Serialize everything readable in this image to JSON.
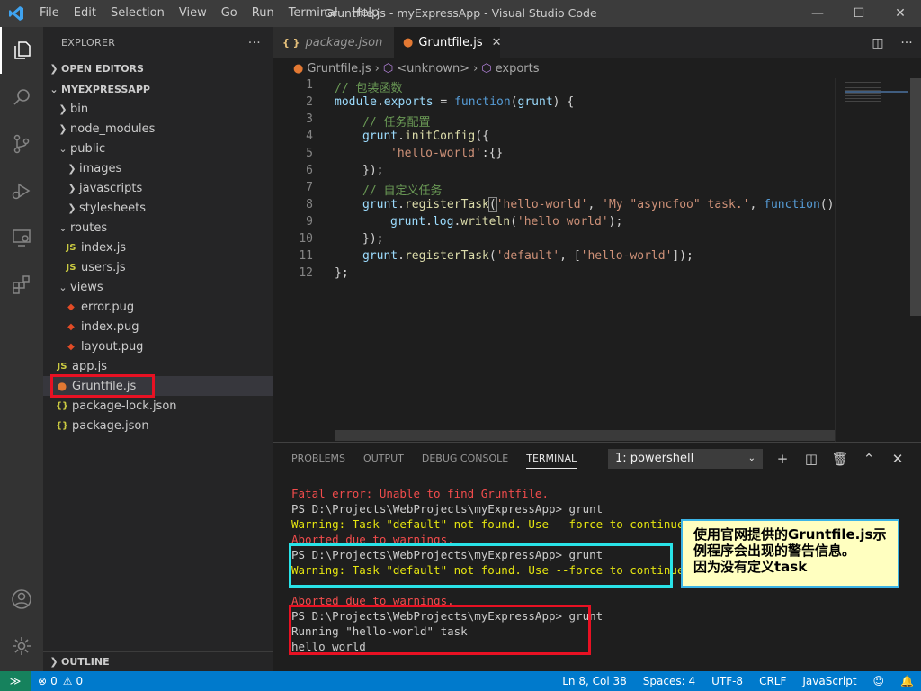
{
  "window": {
    "title": "Gruntfile.js - myExpressApp - Visual Studio Code",
    "menu": [
      "File",
      "Edit",
      "Selection",
      "View",
      "Go",
      "Run",
      "Terminal",
      "Help"
    ]
  },
  "sidebar": {
    "header": "EXPLORER",
    "more": "···",
    "open_editors": "OPEN EDITORS",
    "project": "MYEXPRESSAPP",
    "outline": "OUTLINE",
    "items": [
      {
        "label": "bin",
        "type": "folder",
        "depth": 0,
        "expanded": false
      },
      {
        "label": "node_modules",
        "type": "folder",
        "depth": 0,
        "expanded": false
      },
      {
        "label": "public",
        "type": "folder",
        "depth": 0,
        "expanded": true
      },
      {
        "label": "images",
        "type": "folder",
        "depth": 1,
        "expanded": false
      },
      {
        "label": "javascripts",
        "type": "folder",
        "depth": 1,
        "expanded": false
      },
      {
        "label": "stylesheets",
        "type": "folder",
        "depth": 1,
        "expanded": false
      },
      {
        "label": "routes",
        "type": "folder",
        "depth": 0,
        "expanded": true
      },
      {
        "label": "index.js",
        "type": "js",
        "depth": 1
      },
      {
        "label": "users.js",
        "type": "js",
        "depth": 1
      },
      {
        "label": "views",
        "type": "folder",
        "depth": 0,
        "expanded": true
      },
      {
        "label": "error.pug",
        "type": "pug",
        "depth": 1
      },
      {
        "label": "index.pug",
        "type": "pug",
        "depth": 1
      },
      {
        "label": "layout.pug",
        "type": "pug",
        "depth": 1
      },
      {
        "label": "app.js",
        "type": "js",
        "depth": 0
      },
      {
        "label": "Gruntfile.js",
        "type": "grunt",
        "depth": 0,
        "selected": true
      },
      {
        "label": "package-lock.json",
        "type": "json",
        "depth": 0
      },
      {
        "label": "package.json",
        "type": "json",
        "depth": 0
      }
    ]
  },
  "tabs": [
    {
      "label": "package.json",
      "active": false
    },
    {
      "label": "Gruntfile.js",
      "active": true
    }
  ],
  "breadcrumb": [
    "Gruntfile.js",
    "<unknown>",
    "exports"
  ],
  "code_lines": [
    "1",
    "2",
    "3",
    "4",
    "5",
    "6",
    "7",
    "8",
    "9",
    "10",
    "11",
    "12"
  ],
  "code": {
    "l1": "// 包装函数",
    "l2a": "module",
    "l2b": ".",
    "l2c": "exports",
    "l2d": " = ",
    "l2e": "function",
    "l2f": "(",
    "l2g": "grunt",
    "l2h": ") {",
    "l3": "// 任务配置",
    "l4a": "grunt",
    "l4b": ".",
    "l4c": "initConfig",
    "l4d": "({",
    "l5a": "'hello-world'",
    "l5b": ":{}",
    "l6": "});",
    "l7": "// 自定义任务",
    "l8a": "grunt",
    "l8b": ".",
    "l8c": "registerTask",
    "l8d": "(",
    "l8e": "'hello-world'",
    "l8f": ", ",
    "l8g": "'My \"asyncfoo\" task.'",
    "l8h": ", ",
    "l8i": "function",
    "l8j": "() {",
    "l9a": "grunt",
    "l9b": ".",
    "l9c": "log",
    "l9d": ".",
    "l9e": "writeln",
    "l9f": "(",
    "l9g": "'hello world'",
    "l9h": ");",
    "l10": "});",
    "l11a": "grunt",
    "l11b": ".",
    "l11c": "registerTask",
    "l11d": "(",
    "l11e": "'default'",
    "l11f": ", [",
    "l11g": "'hello-world'",
    "l11h": "]);",
    "l12": "};"
  },
  "panel": {
    "tabs": [
      "PROBLEMS",
      "OUTPUT",
      "DEBUG CONSOLE",
      "TERMINAL"
    ],
    "active_tab": "TERMINAL",
    "terminal_select": "1: powershell",
    "lines": [
      {
        "text": "Fatal error: Unable to find Gruntfile.",
        "color": "#f14c4c"
      },
      {
        "text": "PS D:\\Projects\\WebProjects\\myExpressApp> grunt",
        "color": "#cccccc"
      },
      {
        "text": "Warning: Task \"default\" not found. Use --force to continue.",
        "color": "#e5e510"
      },
      {
        "text": "Aborted due to warnings.",
        "color": "#f14c4c"
      },
      {
        "text": "PS D:\\Projects\\WebProjects\\myExpressApp> grunt",
        "color": "#cccccc"
      },
      {
        "text": "Warning: Task \"default\" not found. Use --force to continue.",
        "color": "#e5e510"
      },
      {
        "text": "",
        "color": "#cccccc"
      },
      {
        "text": "Aborted due to warnings.",
        "color": "#f14c4c"
      },
      {
        "text": "PS D:\\Projects\\WebProjects\\myExpressApp> grunt",
        "color": "#cccccc"
      },
      {
        "text": "Running \"hello-world\" task",
        "color": "#cccccc"
      },
      {
        "text": "hello world",
        "color": "#cccccc"
      }
    ]
  },
  "annotation": {
    "line1": "使用官网提供的Gruntfile.js示",
    "line2": "例程序会出现的警告信息。",
    "line3": "因为没有定义task"
  },
  "status": {
    "errors": "0",
    "warnings": "0",
    "position": "Ln 8, Col 38",
    "spaces": "Spaces: 4",
    "encoding": "UTF-8",
    "eol": "CRLF",
    "language": "JavaScript"
  },
  "colors": {
    "accent": "#007acc",
    "highlight_red": "#e81123",
    "highlight_cyan": "#29e3e8"
  }
}
